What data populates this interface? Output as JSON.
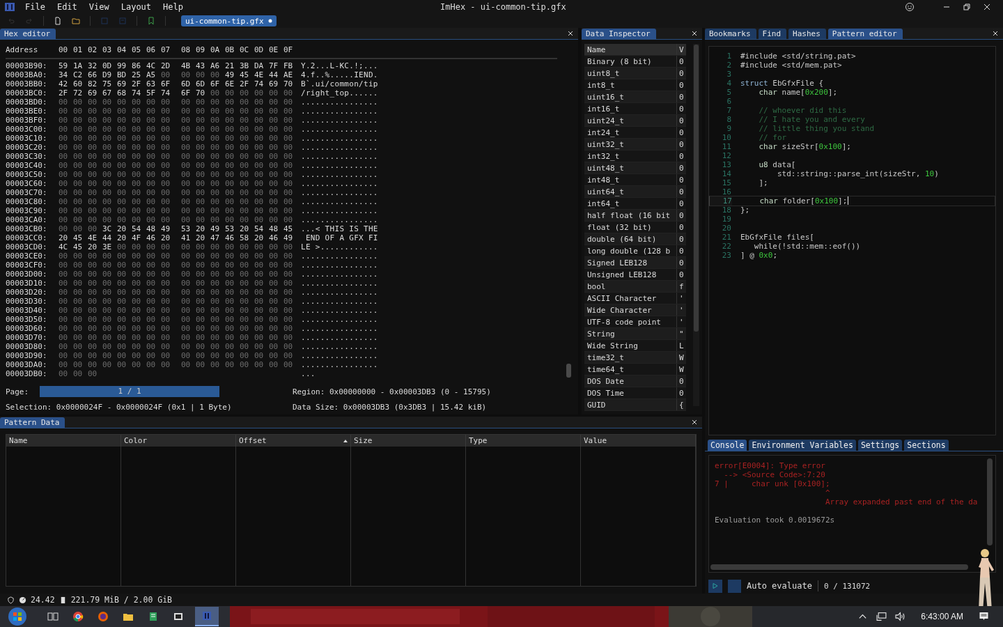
{
  "window": {
    "title": "ImHex - ui-common-tip.gfx"
  },
  "menu": [
    "File",
    "Edit",
    "View",
    "Layout",
    "Help"
  ],
  "file_tab": {
    "label": "ui-common-tip.gfx",
    "modified": true
  },
  "hex_editor": {
    "tab": "Hex editor",
    "address_header": "Address",
    "columns": [
      "00",
      "01",
      "02",
      "03",
      "04",
      "05",
      "06",
      "07",
      "08",
      "09",
      "0A",
      "0B",
      "0C",
      "0D",
      "0E",
      "0F"
    ],
    "rows": [
      {
        "address": "00003B90:",
        "bytes": "59 1A 32 0D 99 86 4C 2D 4B 43 A6 21 3B DA 7F FB",
        "ascii": "Y.2...L-KC.!;..."
      },
      {
        "address": "00003BA0:",
        "bytes": "34 C2 66 D9 BD 25 A5 00 00 00 00 49 45 4E 44 AE",
        "ascii": "4.f..%.....IEND."
      },
      {
        "address": "00003BB0:",
        "bytes": "42 60 82 75 69 2F 63 6F 6D 6D 6F 6E 2F 74 69 70",
        "ascii": "B`.ui/common/tip"
      },
      {
        "address": "00003BC0:",
        "bytes": "2F 72 69 67 68 74 5F 74 6F 70 00 00 00 00 00 00",
        "ascii": "/right_top......"
      },
      {
        "address": "00003BD0:",
        "bytes": "00 00 00 00 00 00 00 00 00 00 00 00 00 00 00 00",
        "ascii": "................"
      },
      {
        "address": "00003BE0:",
        "bytes": "00 00 00 00 00 00 00 00 00 00 00 00 00 00 00 00",
        "ascii": "................"
      },
      {
        "address": "00003BF0:",
        "bytes": "00 00 00 00 00 00 00 00 00 00 00 00 00 00 00 00",
        "ascii": "................"
      },
      {
        "address": "00003C00:",
        "bytes": "00 00 00 00 00 00 00 00 00 00 00 00 00 00 00 00",
        "ascii": "................"
      },
      {
        "address": "00003C10:",
        "bytes": "00 00 00 00 00 00 00 00 00 00 00 00 00 00 00 00",
        "ascii": "................"
      },
      {
        "address": "00003C20:",
        "bytes": "00 00 00 00 00 00 00 00 00 00 00 00 00 00 00 00",
        "ascii": "................"
      },
      {
        "address": "00003C30:",
        "bytes": "00 00 00 00 00 00 00 00 00 00 00 00 00 00 00 00",
        "ascii": "................"
      },
      {
        "address": "00003C40:",
        "bytes": "00 00 00 00 00 00 00 00 00 00 00 00 00 00 00 00",
        "ascii": "................"
      },
      {
        "address": "00003C50:",
        "bytes": "00 00 00 00 00 00 00 00 00 00 00 00 00 00 00 00",
        "ascii": "................"
      },
      {
        "address": "00003C60:",
        "bytes": "00 00 00 00 00 00 00 00 00 00 00 00 00 00 00 00",
        "ascii": "................"
      },
      {
        "address": "00003C70:",
        "bytes": "00 00 00 00 00 00 00 00 00 00 00 00 00 00 00 00",
        "ascii": "................"
      },
      {
        "address": "00003C80:",
        "bytes": "00 00 00 00 00 00 00 00 00 00 00 00 00 00 00 00",
        "ascii": "................"
      },
      {
        "address": "00003C90:",
        "bytes": "00 00 00 00 00 00 00 00 00 00 00 00 00 00 00 00",
        "ascii": "................"
      },
      {
        "address": "00003CA0:",
        "bytes": "00 00 00 00 00 00 00 00 00 00 00 00 00 00 00 00",
        "ascii": "................"
      },
      {
        "address": "00003CB0:",
        "bytes": "00 00 00 3C 20 54 48 49 53 20 49 53 20 54 48 45",
        "ascii": "...< THIS IS THE"
      },
      {
        "address": "00003CC0:",
        "bytes": "20 45 4E 44 20 4F 46 20 41 20 47 46 58 20 46 49",
        "ascii": " END OF A GFX FI"
      },
      {
        "address": "00003CD0:",
        "bytes": "4C 45 20 3E 00 00 00 00 00 00 00 00 00 00 00 00",
        "ascii": "LE >............"
      },
      {
        "address": "00003CE0:",
        "bytes": "00 00 00 00 00 00 00 00 00 00 00 00 00 00 00 00",
        "ascii": "................"
      },
      {
        "address": "00003CF0:",
        "bytes": "00 00 00 00 00 00 00 00 00 00 00 00 00 00 00 00",
        "ascii": "................"
      },
      {
        "address": "00003D00:",
        "bytes": "00 00 00 00 00 00 00 00 00 00 00 00 00 00 00 00",
        "ascii": "................"
      },
      {
        "address": "00003D10:",
        "bytes": "00 00 00 00 00 00 00 00 00 00 00 00 00 00 00 00",
        "ascii": "................"
      },
      {
        "address": "00003D20:",
        "bytes": "00 00 00 00 00 00 00 00 00 00 00 00 00 00 00 00",
        "ascii": "................"
      },
      {
        "address": "00003D30:",
        "bytes": "00 00 00 00 00 00 00 00 00 00 00 00 00 00 00 00",
        "ascii": "................"
      },
      {
        "address": "00003D40:",
        "bytes": "00 00 00 00 00 00 00 00 00 00 00 00 00 00 00 00",
        "ascii": "................"
      },
      {
        "address": "00003D50:",
        "bytes": "00 00 00 00 00 00 00 00 00 00 00 00 00 00 00 00",
        "ascii": "................"
      },
      {
        "address": "00003D60:",
        "bytes": "00 00 00 00 00 00 00 00 00 00 00 00 00 00 00 00",
        "ascii": "................"
      },
      {
        "address": "00003D70:",
        "bytes": "00 00 00 00 00 00 00 00 00 00 00 00 00 00 00 00",
        "ascii": "................"
      },
      {
        "address": "00003D80:",
        "bytes": "00 00 00 00 00 00 00 00 00 00 00 00 00 00 00 00",
        "ascii": "................"
      },
      {
        "address": "00003D90:",
        "bytes": "00 00 00 00 00 00 00 00 00 00 00 00 00 00 00 00",
        "ascii": "................"
      },
      {
        "address": "00003DA0:",
        "bytes": "00 00 00 00 00 00 00 00 00 00 00 00 00 00 00 00",
        "ascii": "................"
      },
      {
        "address": "00003DB0:",
        "bytes": "00 00 00",
        "ascii": "..."
      }
    ],
    "page_label": "Page:",
    "page": "1 / 1",
    "region": "Region: 0x00000000 - 0x00003DB3 (0 - 15795)",
    "selection": "Selection: 0x0000024F - 0x0000024F (0x1 | 1 Byte)",
    "data_size": "Data Size: 0x00003DB3 (0x3DB3 | 15.42 kiB)"
  },
  "data_inspector": {
    "tab": "Data Inspector",
    "columns": [
      "Name",
      "V"
    ],
    "rows": [
      {
        "name": "Binary (8 bit)",
        "value": "0"
      },
      {
        "name": "uint8_t",
        "value": "0"
      },
      {
        "name": "int8_t",
        "value": "0"
      },
      {
        "name": "uint16_t",
        "value": "0"
      },
      {
        "name": "int16_t",
        "value": "0"
      },
      {
        "name": "uint24_t",
        "value": "0"
      },
      {
        "name": "int24_t",
        "value": "0"
      },
      {
        "name": "uint32_t",
        "value": "0"
      },
      {
        "name": "int32_t",
        "value": "0"
      },
      {
        "name": "uint48_t",
        "value": "0"
      },
      {
        "name": "int48_t",
        "value": "0"
      },
      {
        "name": "uint64_t",
        "value": "0"
      },
      {
        "name": "int64_t",
        "value": "0"
      },
      {
        "name": "half float (16 bit",
        "value": "0"
      },
      {
        "name": "float (32 bit)",
        "value": "0"
      },
      {
        "name": "double (64 bit)",
        "value": "0"
      },
      {
        "name": "long double (128 b",
        "value": "0"
      },
      {
        "name": "Signed LEB128",
        "value": "0"
      },
      {
        "name": "Unsigned LEB128",
        "value": "0"
      },
      {
        "name": "bool",
        "value": "f"
      },
      {
        "name": "ASCII Character",
        "value": "'"
      },
      {
        "name": "Wide Character",
        "value": "'"
      },
      {
        "name": "UTF-8 code point",
        "value": "'"
      },
      {
        "name": "String",
        "value": "\""
      },
      {
        "name": "Wide String",
        "value": "L"
      },
      {
        "name": "time32_t",
        "value": "W"
      },
      {
        "name": "time64_t",
        "value": "W"
      },
      {
        "name": "DOS Date",
        "value": "0"
      },
      {
        "name": "DOS Time",
        "value": "0"
      },
      {
        "name": "GUID",
        "value": "{"
      }
    ]
  },
  "right_tabs": [
    {
      "label": "Bookmarks",
      "selected": false
    },
    {
      "label": "Find",
      "selected": false
    },
    {
      "label": "Hashes",
      "selected": false
    },
    {
      "label": "Pattern editor",
      "selected": true
    }
  ],
  "code": [
    {
      "num": "1",
      "current": false,
      "parts": [
        {
          "kind": "text",
          "text": "#include <std/string.pat>"
        }
      ]
    },
    {
      "num": "2",
      "current": false,
      "parts": [
        {
          "kind": "text",
          "text": "#include <std/mem.pat>"
        }
      ]
    },
    {
      "num": "3",
      "current": false
    },
    {
      "num": "4",
      "current": false,
      "parts": [
        {
          "kind": "keyword",
          "text": "struct"
        },
        {
          "kind": "text",
          "text": " EbGfxFile {"
        }
      ]
    },
    {
      "num": "5",
      "current": false,
      "parts": [
        {
          "kind": "type",
          "text": "    char"
        },
        {
          "kind": "text",
          "text": " name["
        },
        {
          "kind": "number",
          "text": "0x200"
        },
        {
          "kind": "text",
          "text": "];"
        }
      ]
    },
    {
      "num": "6",
      "current": false
    },
    {
      "num": "7",
      "current": false,
      "parts": [
        {
          "kind": "comment",
          "text": "    // whoever did this"
        }
      ]
    },
    {
      "num": "8",
      "current": false,
      "parts": [
        {
          "kind": "comment",
          "text": "    // I hate you and every"
        }
      ]
    },
    {
      "num": "9",
      "current": false,
      "parts": [
        {
          "kind": "comment",
          "text": "    // little thing you stand"
        }
      ]
    },
    {
      "num": "10",
      "current": false,
      "parts": [
        {
          "kind": "comment",
          "text": "    // for"
        }
      ]
    },
    {
      "num": "11",
      "current": false,
      "parts": [
        {
          "kind": "type",
          "text": "    char"
        },
        {
          "kind": "text",
          "text": " sizeStr["
        },
        {
          "kind": "number",
          "text": "0x100"
        },
        {
          "kind": "text",
          "text": "];"
        }
      ]
    },
    {
      "num": "12",
      "current": false
    },
    {
      "num": "13",
      "current": false,
      "parts": [
        {
          "kind": "type",
          "text": "    u8"
        },
        {
          "kind": "text",
          "text": " data["
        }
      ]
    },
    {
      "num": "14",
      "current": false,
      "parts": [
        {
          "kind": "text",
          "text": "        std::string::parse_int(sizeStr, "
        },
        {
          "kind": "number",
          "text": "10"
        },
        {
          "kind": "text",
          "text": ")"
        }
      ]
    },
    {
      "num": "15",
      "current": false,
      "parts": [
        {
          "kind": "text",
          "text": "    ];"
        }
      ]
    },
    {
      "num": "16",
      "current": false
    },
    {
      "num": "17",
      "current": true,
      "parts": [
        {
          "kind": "type",
          "text": "    char"
        },
        {
          "kind": "text",
          "text": " folder["
        },
        {
          "kind": "number",
          "text": "0x100"
        },
        {
          "kind": "text",
          "text": "];"
        }
      ]
    },
    {
      "num": "18",
      "current": false,
      "parts": [
        {
          "kind": "text",
          "text": "};"
        }
      ]
    },
    {
      "num": "19",
      "current": false
    },
    {
      "num": "20",
      "current": false
    },
    {
      "num": "21",
      "current": false,
      "parts": [
        {
          "kind": "text",
          "text": "EbGfxFile files["
        }
      ]
    },
    {
      "num": "22",
      "current": false,
      "parts": [
        {
          "kind": "text",
          "text": "   while(!std::mem::eof())"
        }
      ]
    },
    {
      "num": "23",
      "current": false,
      "parts": [
        {
          "kind": "text",
          "text": "] @ "
        },
        {
          "kind": "number",
          "text": "0x0"
        },
        {
          "kind": "text",
          "text": ";"
        }
      ]
    }
  ],
  "console_tabs": [
    {
      "label": "Console",
      "selected": true
    },
    {
      "label": "Environment Variables",
      "selected": false
    },
    {
      "label": "Settings",
      "selected": false
    },
    {
      "label": "Sections",
      "selected": false
    }
  ],
  "console": [
    {
      "kind": "error",
      "text": "error[E0004]: Type error"
    },
    {
      "kind": "error",
      "text": "  --> <Source Code>:7:20"
    },
    {
      "kind": "error",
      "text": "7 |     char unk [0x100];"
    },
    {
      "kind": "error",
      "text": "                        ^"
    },
    {
      "kind": "error",
      "text": "                        Array expanded past end of the da"
    },
    {
      "kind": "info",
      "text": "Evaluation took 0.0019672s"
    }
  ],
  "auto_evaluate": {
    "label": "Auto evaluate",
    "checked": false
  },
  "progress": "0 / 131072",
  "pattern_data": {
    "tab": "Pattern Data",
    "columns": [
      {
        "label": "Name",
        "sorted": false
      },
      {
        "label": "Color",
        "sorted": false
      },
      {
        "label": "Offset",
        "sorted": true
      },
      {
        "label": "Size",
        "sorted": false
      },
      {
        "label": "Type",
        "sorted": false
      },
      {
        "label": "Value",
        "sorted": false
      }
    ]
  },
  "status": {
    "fps": "24.42",
    "memory": "221.79 MiB / 2.00 GiB"
  },
  "taskbar": {
    "apps": [
      {
        "kind": "taskview",
        "selected": false
      },
      {
        "kind": "chrome",
        "selected": false
      },
      {
        "kind": "firefox",
        "selected": false
      },
      {
        "kind": "folder",
        "selected": false
      },
      {
        "kind": "sheet",
        "selected": false
      },
      {
        "kind": "archive",
        "selected": false
      },
      {
        "kind": "hex",
        "selected": true
      }
    ],
    "clock": "6:43:00 AM"
  }
}
